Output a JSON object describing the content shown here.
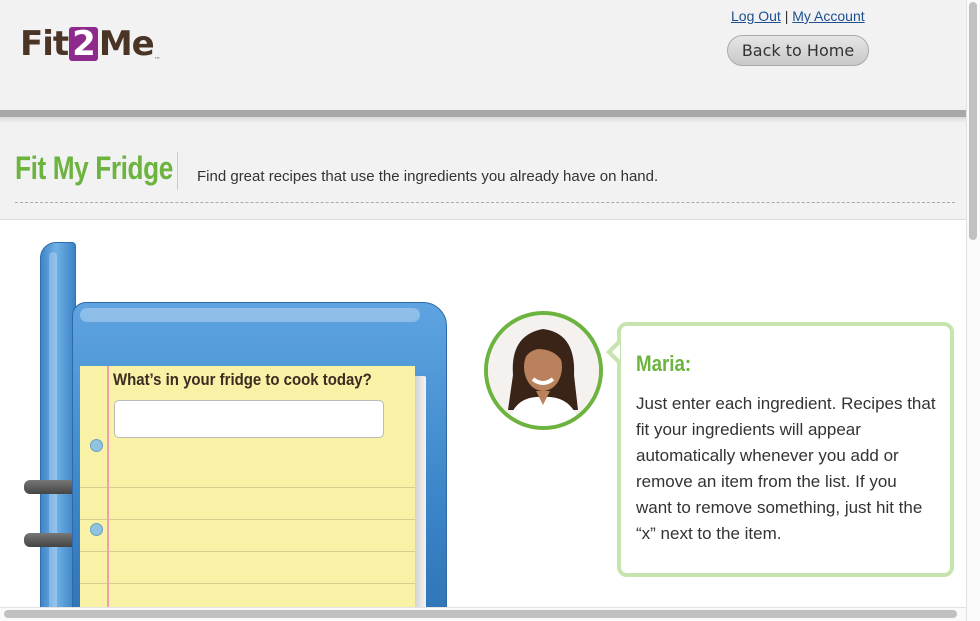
{
  "header": {
    "logo": {
      "prefix": "Fit",
      "highlight": "2",
      "suffix": "Me",
      "tm": "™"
    },
    "links": {
      "logout": "Log Out",
      "separator": "|",
      "account": "My Account"
    },
    "home_button": "Back to Home"
  },
  "page": {
    "title": "Fit My Fridge",
    "subtitle": "Find great recipes that use the ingredients you already have on hand."
  },
  "fridge": {
    "question": "What’s in your fridge to cook today?",
    "input_value": "",
    "input_placeholder": ""
  },
  "guide": {
    "name": "Maria:",
    "message": "Just enter each ingredient. Recipes that fit your ingredients will appear automatically whenever you add or remove an item from the list. If you want to remove something, just hit the “x” next to the item."
  },
  "colors": {
    "brand_green": "#6cb33f",
    "logo_purple": "#8e2a8b",
    "fridge_blue": "#3c86c9",
    "notepad_yellow": "#f8f1a6",
    "link_blue": "#1e4f8f"
  }
}
